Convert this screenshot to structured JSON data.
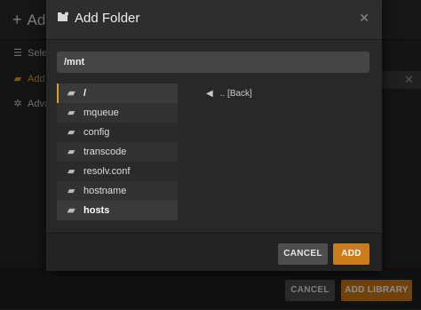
{
  "background_dialog": {
    "title": "Add Library",
    "title_visible": "Ad",
    "nav": [
      {
        "label_visible": "Selec",
        "icon": "list-icon"
      },
      {
        "label_visible": "Add f",
        "icon": "folder-open-icon",
        "active": true
      },
      {
        "label_visible": "Adva",
        "icon": "gear-icon"
      }
    ],
    "footer": {
      "cancel_label": "CANCEL",
      "add_library_label": "ADD LIBRARY"
    }
  },
  "modal": {
    "title": "Add Folder",
    "title_icon": "folder-icon",
    "close_icon": "close-icon",
    "path_value": "/mnt",
    "directories": [
      {
        "name": "/",
        "selected": true
      },
      {
        "name": "mqueue"
      },
      {
        "name": "config"
      },
      {
        "name": "transcode"
      },
      {
        "name": "resolv.conf"
      },
      {
        "name": "hostname"
      },
      {
        "name": "hosts"
      }
    ],
    "back_label": ".. [Back]",
    "footer": {
      "cancel_label": "CANCEL",
      "add_label": "ADD"
    }
  },
  "colors": {
    "accent": "#e5a00d",
    "primary_button": "#cc7b19",
    "secondary_button": "#4e4e4e"
  }
}
